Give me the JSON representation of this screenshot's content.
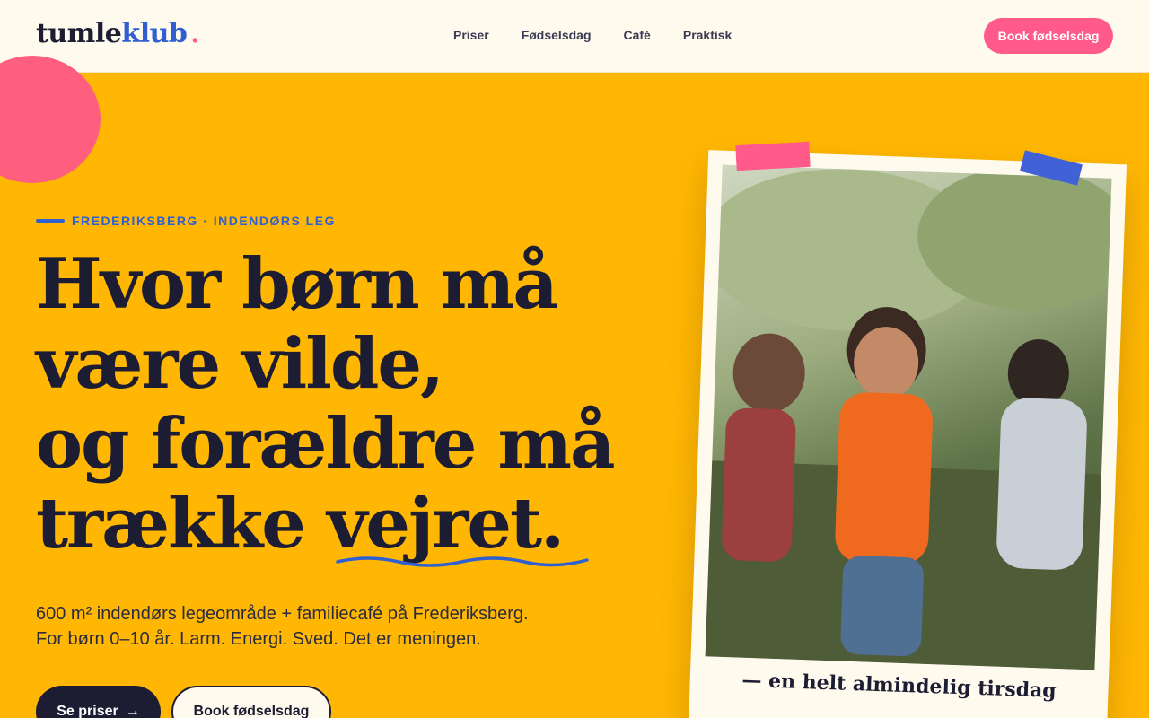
{
  "logo": {
    "word1": "tumle",
    "word2": "klub",
    "dot": "."
  },
  "nav": {
    "items": [
      "Priser",
      "Fødselsdag",
      "Café",
      "Praktisk"
    ]
  },
  "header": {
    "cta": "Book fødselsdag"
  },
  "hero": {
    "eyebrow": "FREDERIKSBERG · INDENDØRS LEG",
    "headline": {
      "line1": "Hvor børn må",
      "line2": "være vilde,",
      "line3": "og forældre må",
      "line4_a": "trække ",
      "line4_highlight": "vejret."
    },
    "subtitle_line1": "600 m² indendørs legeområde + familiecafé på Frederiksberg.",
    "subtitle_line2": "For børn 0–10 år. Larm. Energi. Sved. Det er meningen.",
    "btn_primary": "Se priser",
    "btn_primary_icon": "→",
    "btn_secondary": "Book fødselsdag"
  },
  "photo": {
    "caption": "— en helt almindelig tirsdag",
    "icon": "photo-kids-playing"
  },
  "colors": {
    "background": "#ffb703",
    "accent_pink": "#ff5a8a",
    "accent_blue": "#2f5fd0",
    "ink": "#1c1d33",
    "cream": "#fffaee"
  }
}
